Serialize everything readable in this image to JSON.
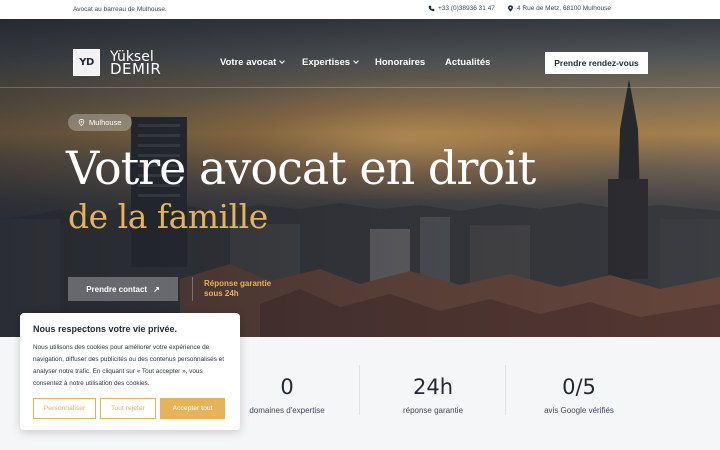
{
  "topbar": {
    "tagline": "Avocat au barreau de Mulhouse.",
    "phone": "+33 (0)38936 31 47",
    "address": "4 Rue de Metz, 68100 Mulhouse"
  },
  "brand": {
    "mark": "YD",
    "first_name": "Yüksel",
    "last_name": "DEMIR"
  },
  "nav": {
    "items": [
      {
        "label": "Votre avocat",
        "has_dropdown": true
      },
      {
        "label": "Expertises",
        "has_dropdown": true
      },
      {
        "label": "Honoraires",
        "has_dropdown": false
      },
      {
        "label": "Actualités",
        "has_dropdown": false
      }
    ],
    "cta_label": "Prendre rendez-vous"
  },
  "hero": {
    "location": "Mulhouse",
    "title_line1": "Votre avocat en droit",
    "title_line2": "de la famille",
    "contact_label": "Prendre contact",
    "guarantee_line1": "Réponse garantie",
    "guarantee_line2": "sous 24h"
  },
  "stats": [
    {
      "value": "0",
      "label": "domaines d'expertise"
    },
    {
      "value": "24h",
      "label": "réponse garantie"
    },
    {
      "value": "0/5",
      "label": "avis Google vérifiés"
    }
  ],
  "cookie": {
    "title": "Nous respectons votre vie privée.",
    "body": "Nous utilisons des cookies pour améliorer votre expérience de navigation, diffuser des publicités ou des contenus personnalisés et analyser notre trafic. En cliquant sur « Tout accepter », vous consentez à notre utilisation des cookies.",
    "customize_label": "Personnaliser",
    "reject_label": "Tout rejeter",
    "accept_label": "Accepter tout"
  },
  "colors": {
    "accent": "#e6b25a",
    "dark": "#1f2a36"
  },
  "icons": {
    "phone": "phone-icon",
    "address": "map-pin-icon",
    "location": "map-pin-icon",
    "contact_arrow": "arrow-up-right-icon"
  }
}
